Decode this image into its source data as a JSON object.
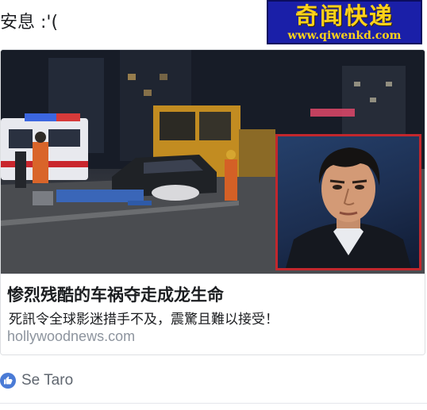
{
  "post": {
    "status_text": "安息 :'("
  },
  "watermark": {
    "title": "奇闻快递",
    "url": "www.qiwenkd.com"
  },
  "link_preview": {
    "headline": "惨烈残酷的车祸夺走成龙生命",
    "subtitle": "死訊令全球影迷措手不及，震驚且難以接受！",
    "domain": "hollywoodnews.com"
  },
  "reactions": {
    "icon": "thumbs-up-icon",
    "name": "Se Taro",
    "accent_color": "#4a7bd6"
  }
}
